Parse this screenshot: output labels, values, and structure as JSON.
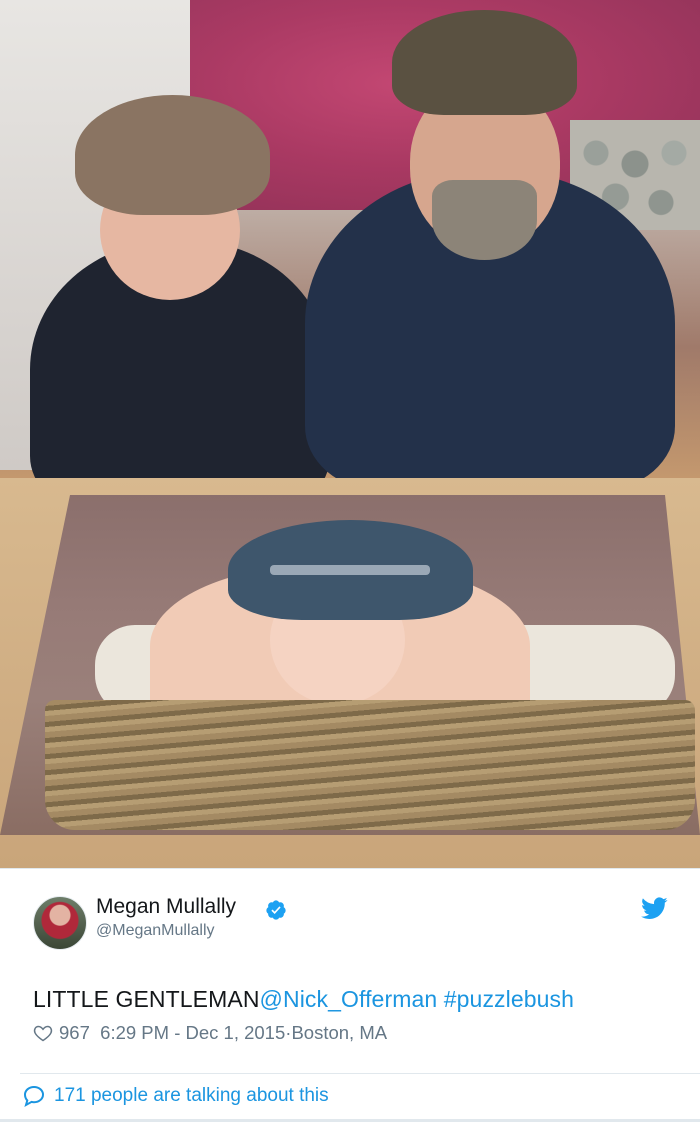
{
  "tweet": {
    "author_name": "Megan Mullally",
    "handle": "@MeganMullally",
    "text_main": "LITTLE GENTLEMAN",
    "mention": "@Nick_Offerman",
    "hashtag": "#puzzlebush",
    "likes": "967",
    "timestamp": "6:29 PM - Dec 1, 2015",
    "separator": " · ",
    "location": "Boston, MA",
    "talking_about": "171 people are talking about this"
  },
  "colors": {
    "link": "#1b95e0",
    "verified": "#1da1f2",
    "meta": "#657786",
    "text": "#14171a"
  },
  "icons": {
    "verified": "verified-badge-icon",
    "platform": "twitter-bird-icon",
    "like": "heart-icon",
    "reply": "speech-bubble-icon"
  }
}
